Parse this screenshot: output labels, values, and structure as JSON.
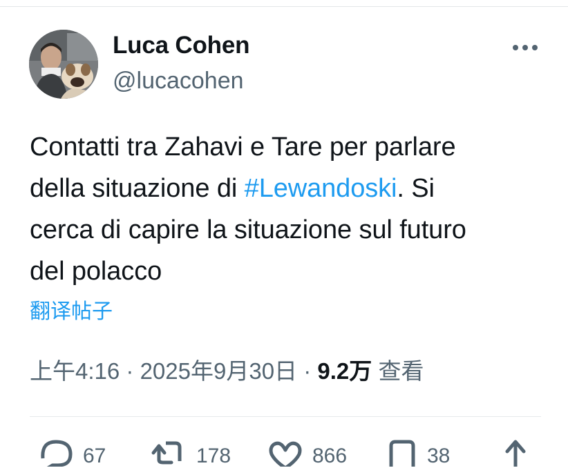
{
  "author": {
    "display_name": "Luca Cohen",
    "handle": "@lucacohen"
  },
  "tweet": {
    "lines": [
      {
        "before": "Contatti tra Zahavi e Tare per parlare",
        "hashtag": "",
        "after": ""
      },
      {
        "before": "della situazione di ",
        "hashtag": "#Lewandoski",
        "after": ". Si"
      },
      {
        "before": "cerca di capire la situazione sul futuro",
        "hashtag": "",
        "after": ""
      },
      {
        "before": "del polacco",
        "hashtag": "",
        "after": ""
      }
    ],
    "translate_label": "翻译帖子"
  },
  "meta": {
    "time": "上午4:16",
    "separator": "·",
    "date": "2025年9月30日",
    "separator2": "·",
    "views_count": "9.2万",
    "views_label": "查看"
  },
  "actions": {
    "reply_count": "67",
    "retweet_count": "178",
    "like_count": "866",
    "bookmark_count": "38"
  },
  "colors": {
    "accent": "#1d9bf0",
    "secondary_text": "#536471",
    "primary_text": "#0f1419"
  },
  "icons": [
    "more-icon",
    "reply-icon",
    "retweet-icon",
    "like-icon",
    "bookmark-icon",
    "share-icon"
  ]
}
